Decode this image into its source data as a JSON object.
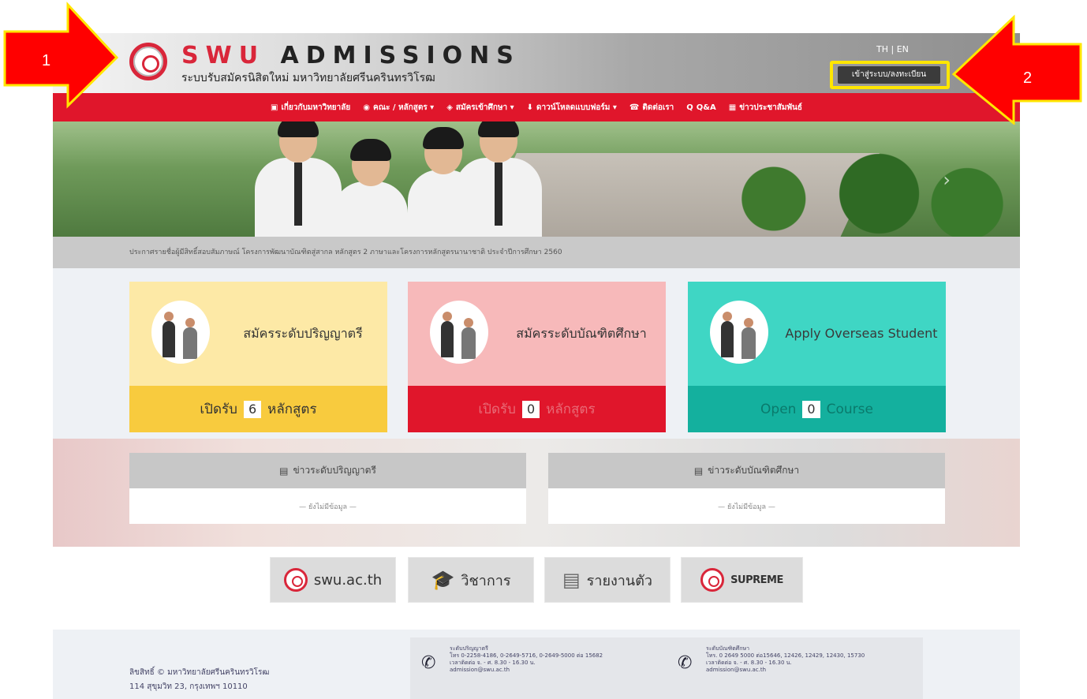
{
  "header": {
    "title_prefix": "SWU",
    "title_rest": "ADMISSIONS",
    "subtitle": "ระบบรับสมัครนิสิตใหม่ มหาวิทยาลัยศรีนครินทรวิโรฒ",
    "lang": "TH | EN",
    "login_label": "เข้าสู่ระบบ/ลงทะเบียน"
  },
  "nav": {
    "items": [
      {
        "icon": "▣",
        "label": "เกี่ยวกับมหาวิทยาลัย"
      },
      {
        "icon": "◉",
        "label": "คณะ / หลักสูตร ▾"
      },
      {
        "icon": "◈",
        "label": "สมัครเข้าศึกษา ▾"
      },
      {
        "icon": "⬇",
        "label": "ดาวน์โหลดแบบฟอร์ม ▾"
      },
      {
        "icon": "☎",
        "label": "ติดต่อเรา"
      },
      {
        "icon": "Q",
        "label": "Q&A"
      },
      {
        "icon": "▦",
        "label": "ข่าวประชาสัมพันธ์"
      }
    ]
  },
  "announcement": "ประกาศรายชื่อผู้มีสิทธิ์สอบสัมภาษณ์ โครงการพัฒนาบัณฑิตสู่สากล หลักสูตร 2 ภาษาและโครงการหลักสูตรนานาชาติ ประจำปีการศึกษา 2560",
  "cards": [
    {
      "label": "สมัครระดับปริญญาตรี",
      "open_prefix": "เปิดรับ",
      "count": "6",
      "open_suffix": "หลักสูตร"
    },
    {
      "label": "สมัครระดับบัณฑิตศึกษา",
      "open_prefix": "เปิดรับ",
      "count": "0",
      "open_suffix": "หลักสูตร"
    },
    {
      "label": "Apply Overseas Student",
      "open_prefix": "Open",
      "count": "0",
      "open_suffix": "Course"
    }
  ],
  "news": [
    {
      "title": "ข่าวระดับปริญญาตรี",
      "empty": "— ยังไม่มีข้อมูล —"
    },
    {
      "title": "ข่าวระดับบัณฑิตศึกษา",
      "empty": "— ยังไม่มีข้อมูล —"
    }
  ],
  "links": [
    {
      "label": "swu.ac.th"
    },
    {
      "label": "วิชาการ"
    },
    {
      "label": "รายงานตัว"
    },
    {
      "label": "SUPREME"
    }
  ],
  "footer": {
    "copyright": "ลิขสิทธิ์ © มหาวิทยาลัยศรีนครินทรวิโรฒ",
    "address": "114 สุขุมวิท 23, กรุงเทพฯ 10110",
    "contacts": [
      {
        "title": "ระดับปริญญาตรี",
        "phone": "โทร 0-2258-4186, 0-2649-5716, 0-2649-5000 ต่อ 15682",
        "hours": "เวลาติดต่อ จ. - ศ. 8.30 - 16.30 น.",
        "email": "admission@swu.ac.th"
      },
      {
        "title": "ระดับบัณฑิตศึกษา",
        "phone": "โทร. 0 2649 5000 ต่อ15646, 12426, 12429, 12430, 15730",
        "hours": "เวลาติดต่อ จ. - ศ. 8.30 - 16.30 น.",
        "email": "admission@swu.ac.th"
      }
    ]
  },
  "annotations": {
    "arrow1": "1",
    "arrow2": "2"
  },
  "colors": {
    "brand_red": "#e0162b",
    "highlight_yellow": "#ffe600"
  }
}
